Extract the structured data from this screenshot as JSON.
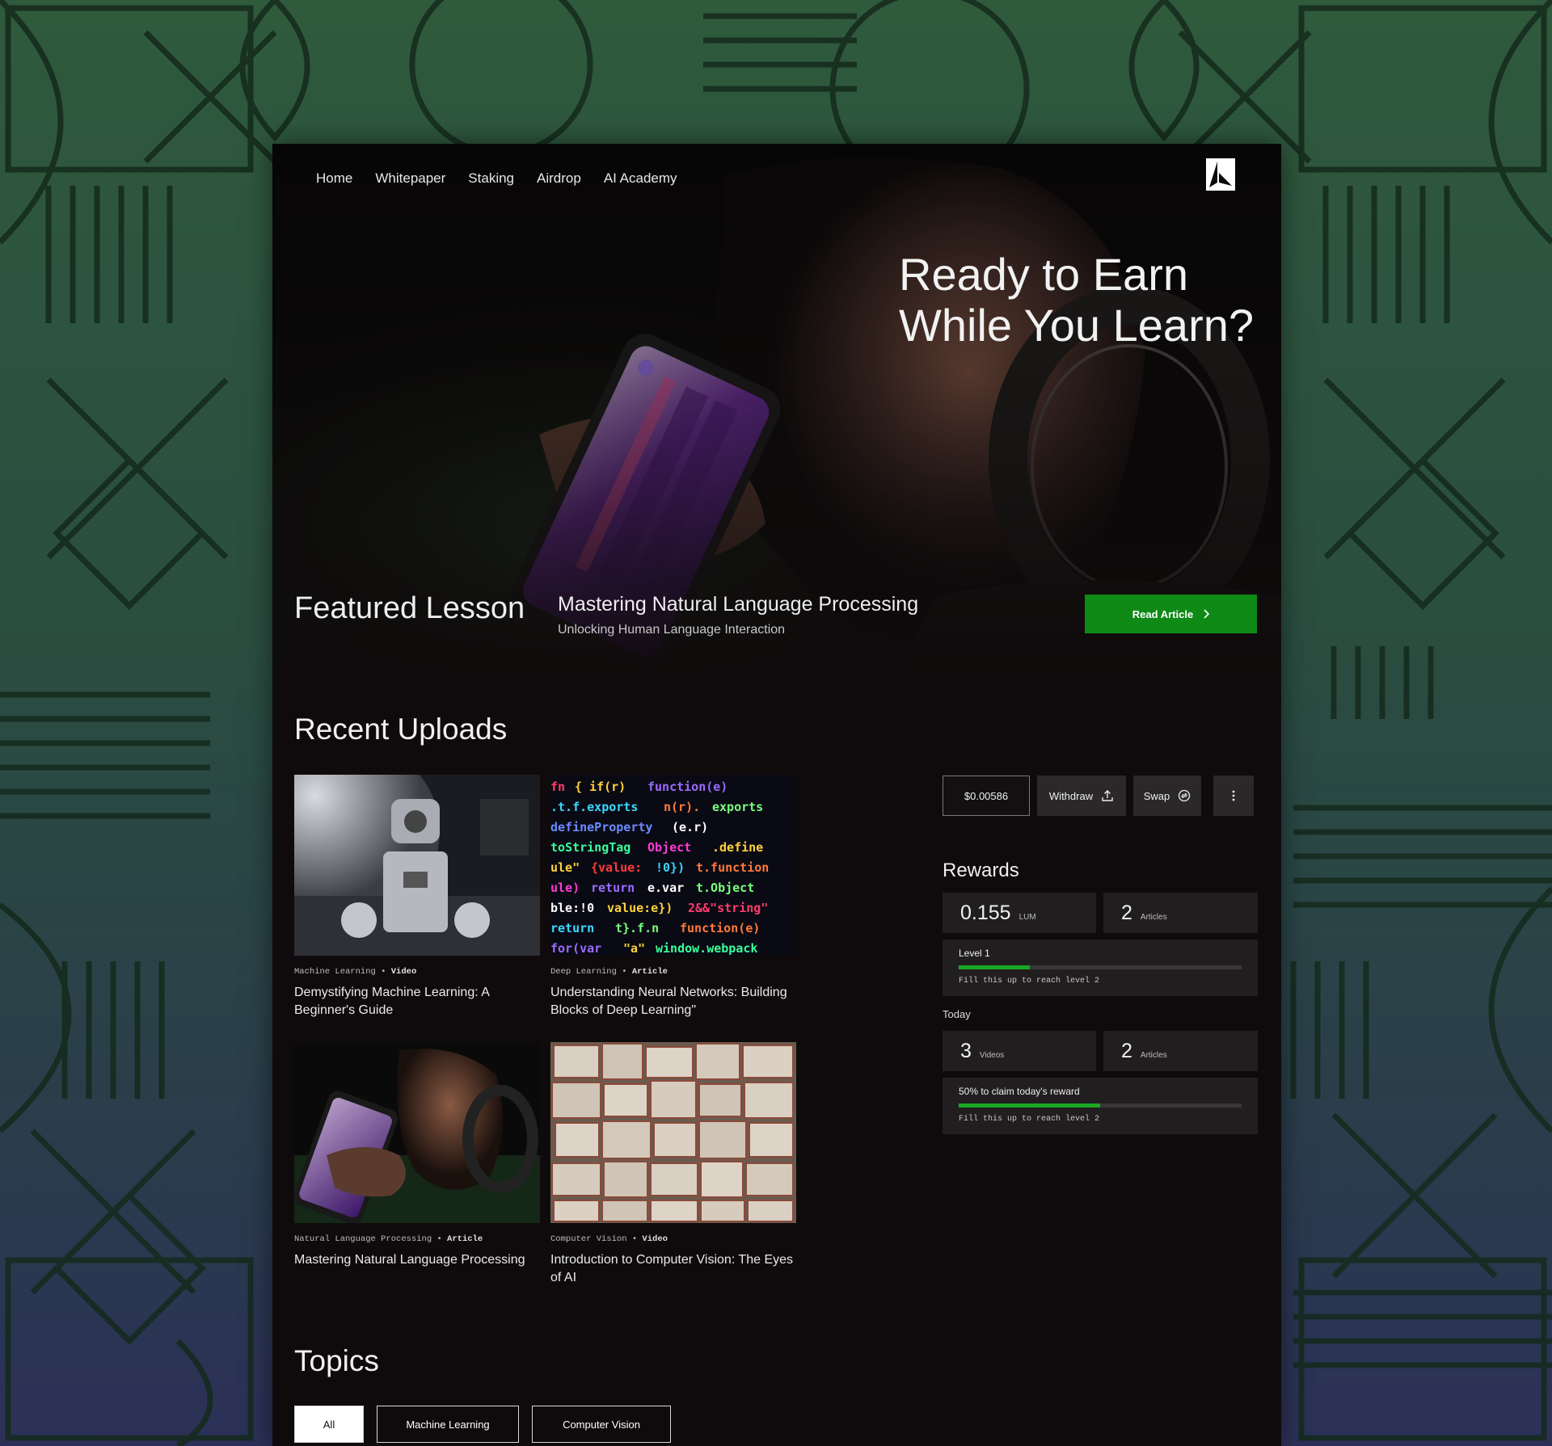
{
  "nav": {
    "items": [
      "Home",
      "Whitepaper",
      "Staking",
      "Airdrop",
      "AI Academy"
    ]
  },
  "hero": {
    "title": "Ready to Earn While You Learn?",
    "featured_label": "Featured Lesson",
    "featured_title": "Mastering Natural Language Processing",
    "featured_subtitle": "Unlocking Human Language Interaction",
    "read_button": "Read Article"
  },
  "recent": {
    "title": "Recent Uploads",
    "cards": [
      {
        "category": "Machine Learning",
        "type": "Video",
        "title": "Demystifying Machine Learning: A Beginner's Guide"
      },
      {
        "category": "Deep Learning",
        "type": "Article",
        "title": "Understanding Neural Networks: Building Blocks of Deep Learning\""
      },
      {
        "category": "Natural Language Processing",
        "type": "Article",
        "title": "Mastering Natural Language Processing"
      },
      {
        "category": "Computer Vision",
        "type": "Video",
        "title": "Introduction to Computer Vision: The Eyes of AI"
      }
    ]
  },
  "wallet": {
    "balance": "$0.00586",
    "withdraw_label": "Withdraw",
    "swap_label": "Swap"
  },
  "rewards": {
    "title": "Rewards",
    "amount": "0.155",
    "amount_unit": "LUM",
    "articles_count": "2",
    "articles_label": "Articles",
    "level_label": "Level 1",
    "level_progress": 0.25,
    "level_hint": "Fill this up to reach level 2"
  },
  "today": {
    "title": "Today",
    "videos_count": "3",
    "videos_label": "Videos",
    "articles_count": "2",
    "articles_label": "Articles",
    "claim_label": "50% to claim today's reward",
    "claim_progress": 0.5,
    "claim_hint": "Fill this up to reach level 2"
  },
  "topics": {
    "title": "Topics",
    "items": [
      "All",
      "Machine Learning",
      "Computer Vision"
    ],
    "active": "All"
  },
  "colors": {
    "accent_green": "#0f8a17",
    "page_bg": "#0f0b0c",
    "panel_bg": "#211e1f"
  }
}
